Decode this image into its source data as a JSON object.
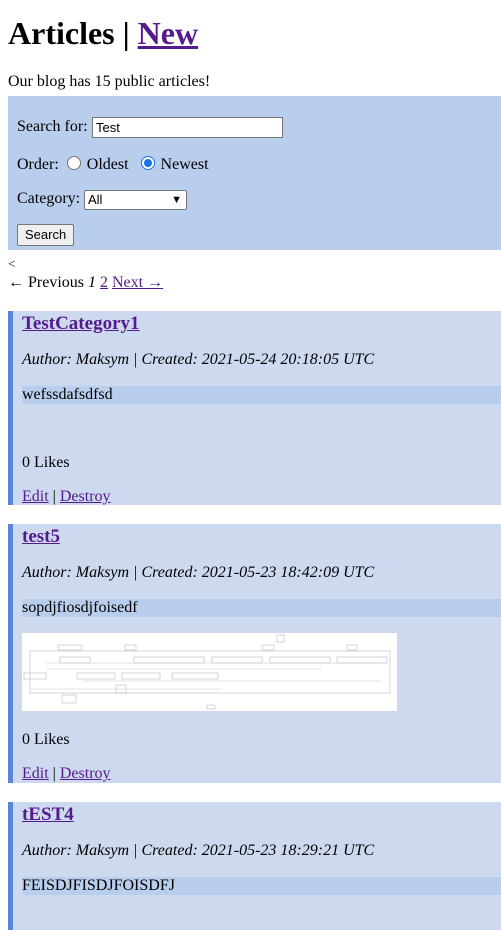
{
  "header": {
    "title": "Articles",
    "separator": "|",
    "new_link": "New"
  },
  "intro": "Our blog has 15 public articles!",
  "search": {
    "label": "Search for:",
    "value": "Test",
    "order_label": "Order:",
    "order_options": [
      "Oldest",
      "Newest"
    ],
    "order_selected": "Newest",
    "category_label": "Category:",
    "category_value": "All",
    "button": "Search"
  },
  "stray": "<",
  "pager": {
    "previous": "← Previous",
    "current": "1",
    "page2": "2",
    "next": "Next →"
  },
  "articles": [
    {
      "title": "TestCategory1",
      "meta": "Author: Maksym | Created: 2021-05-24 20:18:05 UTC",
      "body": "wefssdafsdfsd",
      "likes": "0 Likes",
      "edit": "Edit",
      "sep": "|",
      "destroy": "Destroy"
    },
    {
      "title": "test5",
      "meta": "Author: Maksym | Created: 2021-05-23 18:42:09 UTC",
      "body": "sopdjfiosdjfoisedf",
      "likes": "0 Likes",
      "edit": "Edit",
      "sep": "|",
      "destroy": "Destroy"
    },
    {
      "title": "tEST4",
      "meta": "Author: Maksym | Created: 2021-05-23 18:29:21 UTC",
      "body": "FEISDJFISDJFOISDFJ"
    }
  ],
  "colors": {
    "panel": "#b9cdec",
    "article_bg": "#ccd9ee",
    "article_border": "#5b85d6",
    "link": "#551a8b"
  }
}
